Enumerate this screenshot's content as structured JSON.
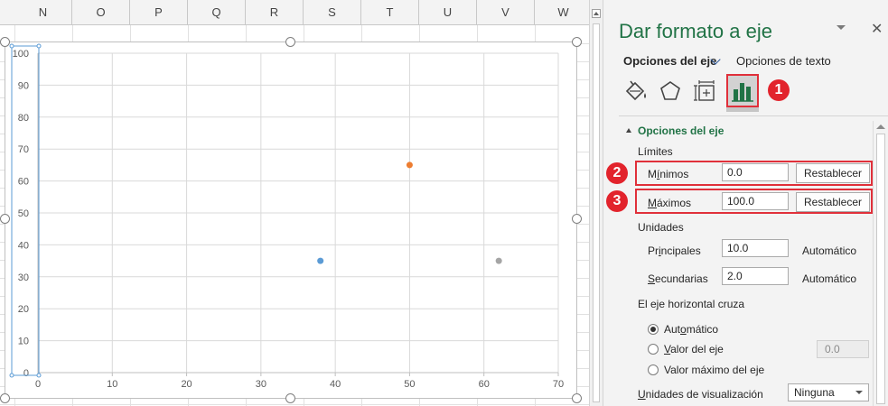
{
  "spreadsheet": {
    "columns": [
      "N",
      "O",
      "P",
      "Q",
      "R",
      "S",
      "T",
      "U",
      "V",
      "W"
    ]
  },
  "chart_data": {
    "type": "scatter",
    "title": "",
    "xlabel": "",
    "ylabel": "",
    "xlim": [
      0,
      70
    ],
    "ylim": [
      0,
      100
    ],
    "x_ticks": [
      0,
      10,
      20,
      30,
      40,
      50,
      60,
      70
    ],
    "y_ticks": [
      0,
      10,
      20,
      30,
      40,
      50,
      60,
      70,
      80,
      90,
      100
    ],
    "grid": true,
    "points": [
      {
        "x": 38,
        "y": 35,
        "color": "#5b9bd5"
      },
      {
        "x": 50,
        "y": 65,
        "color": "#ed7d31"
      },
      {
        "x": 62,
        "y": 35,
        "color": "#a5a5a5"
      }
    ]
  },
  "pane": {
    "title": "Dar formato a eje",
    "close_symbol": "✕",
    "tabs": {
      "axis_options": "Opciones del eje",
      "text_options": "Opciones de texto"
    },
    "icons": [
      "fill-line-icon",
      "effects-icon",
      "size-properties-icon",
      "axis-options-icon"
    ],
    "badges": [
      "1",
      "2",
      "3"
    ],
    "section_title": "Opciones del eje",
    "limits_label": "Límites",
    "minimum": {
      "label_pre": "M",
      "label_ul": "í",
      "label_post": "nimos",
      "value": "0.0",
      "reset": "Restablecer"
    },
    "maximum": {
      "label_pre": "",
      "label_ul": "M",
      "label_post": "áximos",
      "value": "100.0",
      "reset": "Restablecer"
    },
    "units_label": "Unidades",
    "major": {
      "label_pre": "Pr",
      "label_ul": "i",
      "label_post": "ncipales",
      "value": "10.0",
      "mode": "Automático"
    },
    "minor": {
      "label_pre": "",
      "label_ul": "S",
      "label_post": "ecundarias",
      "value": "2.0",
      "mode": "Automático"
    },
    "crosses_label": "El eje horizontal cruza",
    "crosses_options": {
      "auto": {
        "pre": "Aut",
        "ul": "o",
        "post": "mático"
      },
      "axis_value": {
        "pre": "",
        "ul": "V",
        "post": "alor del eje"
      },
      "max_value": {
        "pre": "Valor máximo del e",
        "ul": "j",
        "post": "e"
      }
    },
    "axis_value_input": "0.0",
    "display_units": {
      "label_pre": "",
      "label_ul": "U",
      "label_post": "nidades de visualización",
      "value": "Ninguna"
    }
  },
  "colors": {
    "accent_green": "#217346",
    "highlight_red": "#e0303a",
    "badge_red": "#e2232c"
  }
}
